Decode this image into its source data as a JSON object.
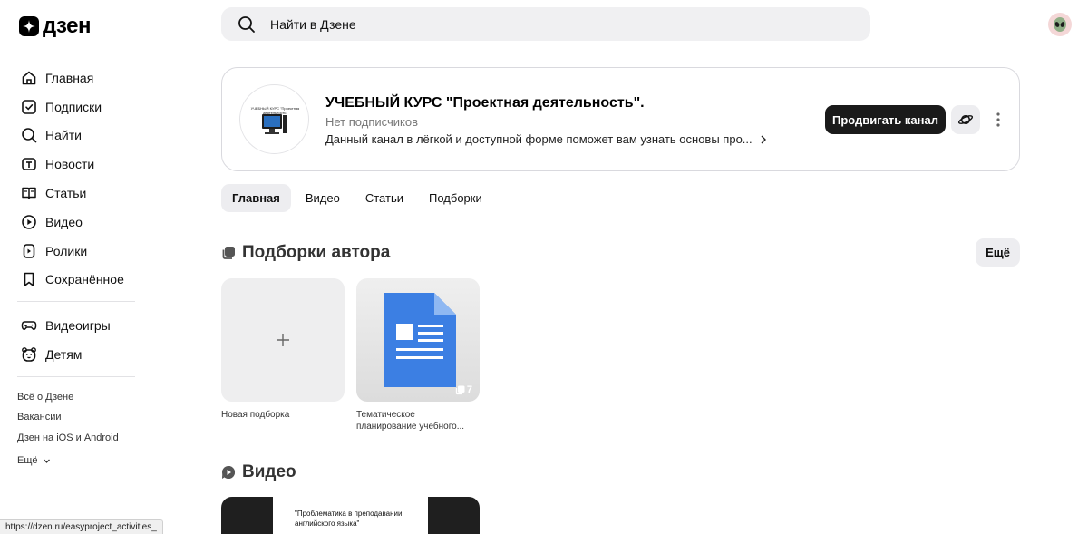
{
  "logo": {
    "text": "дзен"
  },
  "search": {
    "placeholder": "Найти в Дзене"
  },
  "sidebar": {
    "items": [
      {
        "label": "Главная",
        "icon": "home-icon"
      },
      {
        "label": "Подписки",
        "icon": "subscriptions-icon"
      },
      {
        "label": "Найти",
        "icon": "search-icon"
      },
      {
        "label": "Новости",
        "icon": "news-icon"
      },
      {
        "label": "Статьи",
        "icon": "articles-icon"
      },
      {
        "label": "Видео",
        "icon": "video-icon"
      },
      {
        "label": "Ролики",
        "icon": "shorts-icon"
      },
      {
        "label": "Сохранённое",
        "icon": "bookmark-icon"
      }
    ],
    "extra_items": [
      {
        "label": "Видеоигры",
        "icon": "gamepad-icon"
      },
      {
        "label": "Детям",
        "icon": "kids-icon"
      }
    ],
    "footer_links": [
      "Всё о Дзене",
      "Вакансии",
      "Дзен на iOS и Android"
    ],
    "footer_more": "Ещё"
  },
  "channel": {
    "title": "УЧЕБНЫЙ КУРС \"Проектная деятельность\".",
    "subscribers": "Нет подписчиков",
    "description": "Данный канал в лёгкой и доступной форме поможет вам узнать основы про...",
    "avatar_caption": "УЧЕБНЫЙ КУРС \"Проектная деятельность\"",
    "promote_label": "Продвигать канал"
  },
  "tabs": [
    {
      "label": "Главная",
      "active": true
    },
    {
      "label": "Видео",
      "active": false
    },
    {
      "label": "Статьи",
      "active": false
    },
    {
      "label": "Подборки",
      "active": false
    }
  ],
  "collections": {
    "title": "Подборки автора",
    "more_label": "Ещё",
    "new_label": "Новая подборка",
    "items": [
      {
        "title": "Тематическое планирование учебного...",
        "count": "7"
      }
    ]
  },
  "video_section": {
    "title": "Видео",
    "first_video_text": "\"Проблематика в преподавании английского языка\""
  },
  "status_bar": {
    "url": "https://dzen.ru/easyproject_activities_"
  },
  "colors": {
    "primary_button": "#1a1a1a",
    "doc_icon": "#3c7fe3",
    "tab_active_bg": "#ededf0"
  }
}
